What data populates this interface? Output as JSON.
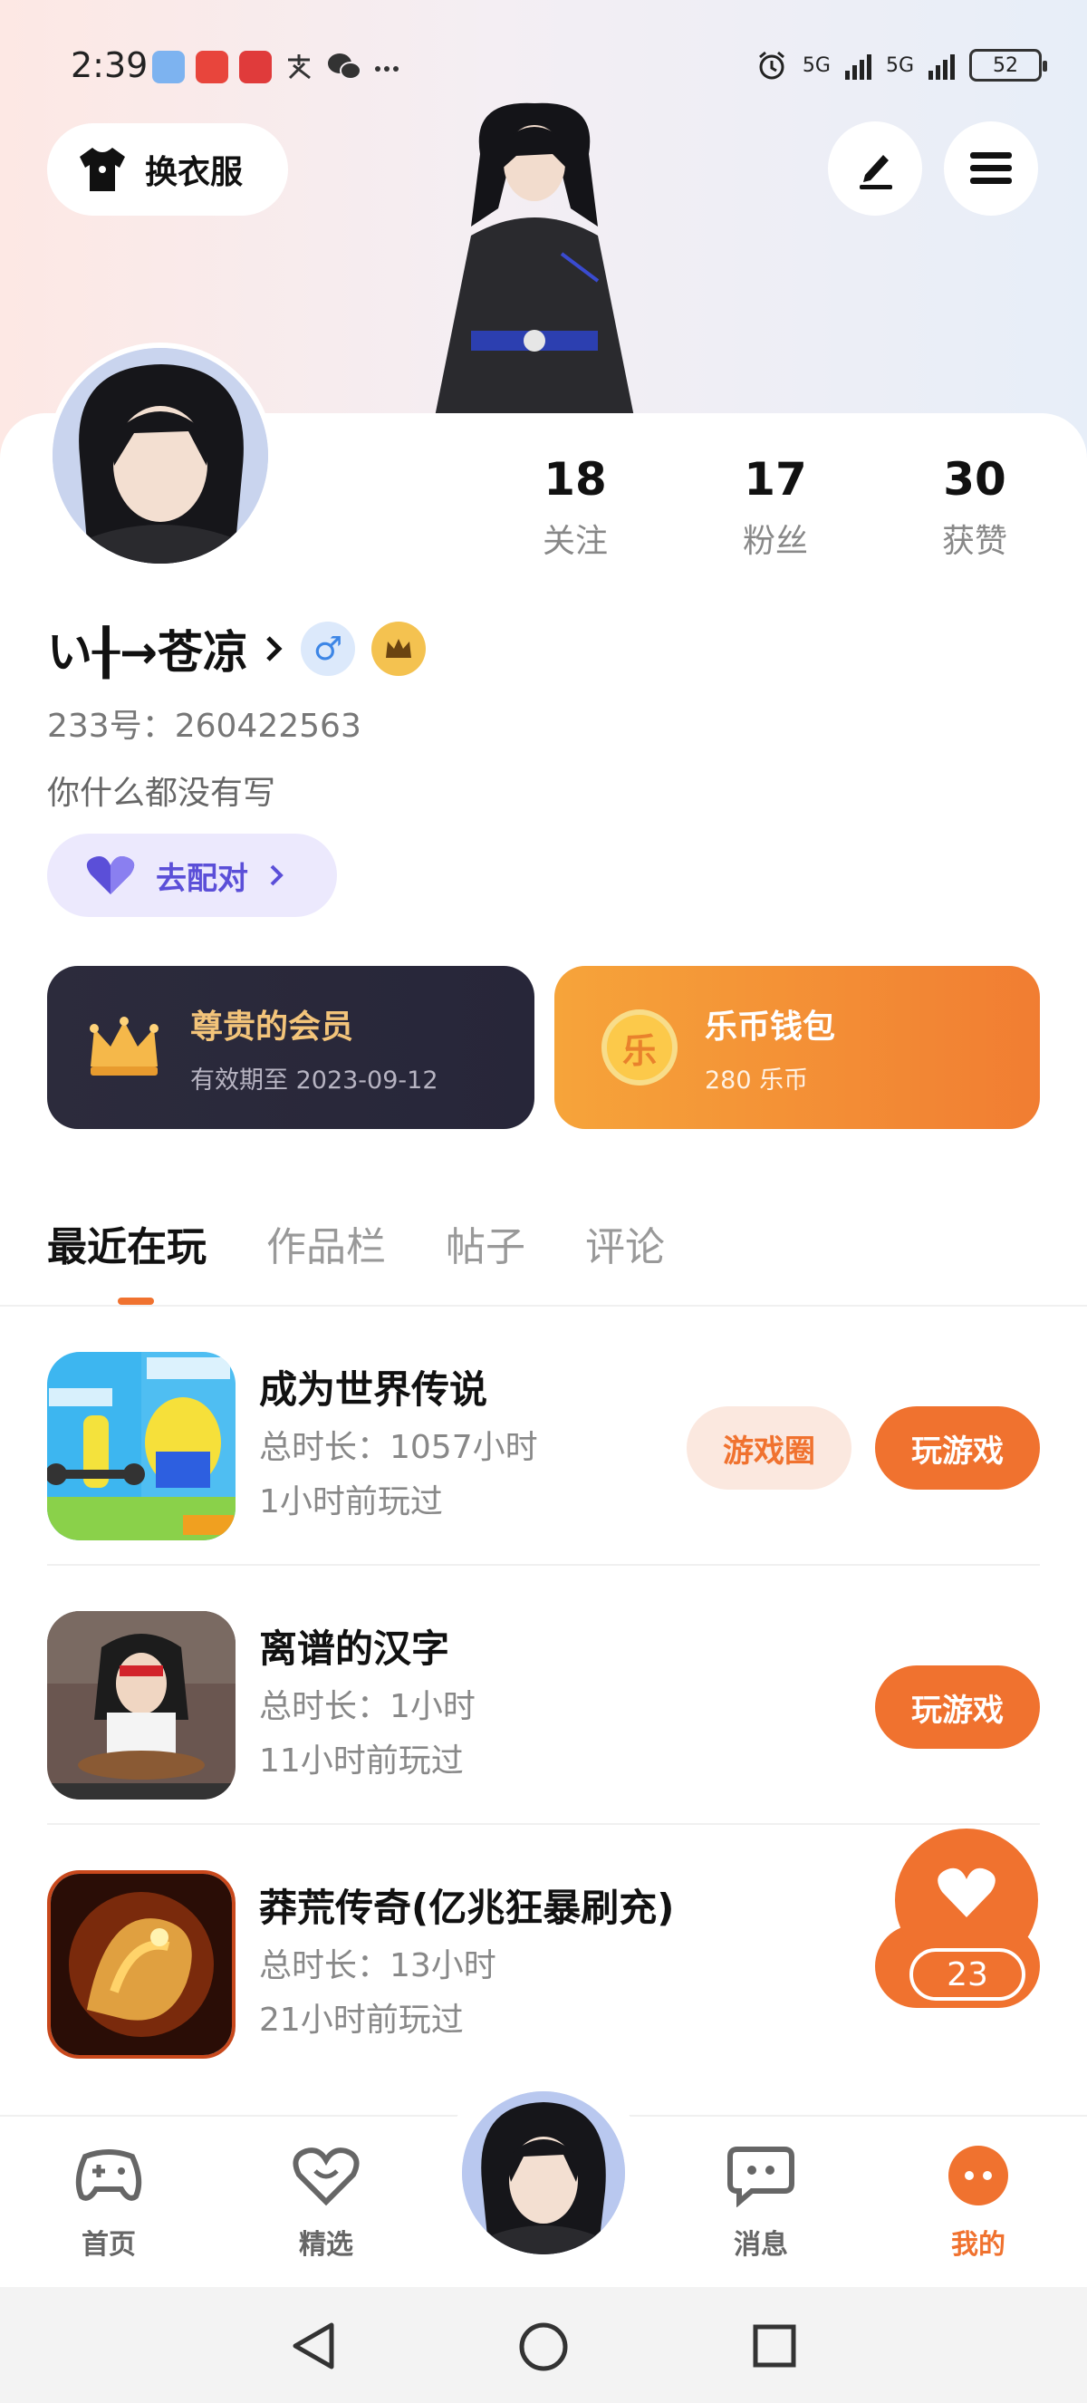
{
  "status_bar": {
    "time": "2:39",
    "network_label": "5G",
    "battery": "52"
  },
  "header": {
    "outfit_label": "换衣服"
  },
  "profile": {
    "username": "い╂→苍凉",
    "gender_symbol": "♂",
    "uid": "233号：260422563",
    "bio": "你什么都没有写",
    "match_label": "去配对",
    "stats": [
      {
        "value": "18",
        "label": "关注"
      },
      {
        "value": "17",
        "label": "粉丝"
      },
      {
        "value": "30",
        "label": "获赞"
      }
    ]
  },
  "vip": {
    "title": "尊贵的会员",
    "subtitle": "有效期至 2023-09-12"
  },
  "wallet": {
    "icon_char": "乐",
    "title": "乐币钱包",
    "subtitle": "280 乐币"
  },
  "tabs": [
    "最近在玩",
    "作品栏",
    "帖子",
    "评论"
  ],
  "games": [
    {
      "name": "成为世界传说",
      "time": "总时长：1057小时",
      "last": "1小时前玩过",
      "circle_label": "游戏圈",
      "play_label": "玩游戏"
    },
    {
      "name": "离谱的汉字",
      "time": "总时长：1小时",
      "last": "11小时前玩过",
      "play_label": "玩游戏"
    },
    {
      "name": "莽荒传奇(亿兆狂暴刷充)",
      "time": "总时长：13小时",
      "last": "21小时前玩过"
    }
  ],
  "like_count": "23",
  "nav": {
    "home": "首页",
    "featured": "精选",
    "messages": "消息",
    "mine": "我的"
  },
  "colors": {
    "accent": "#f0722f",
    "match": "#5b4fd8",
    "vip_bg": "#2c2b3c",
    "wallet_bg": "#f39036"
  }
}
